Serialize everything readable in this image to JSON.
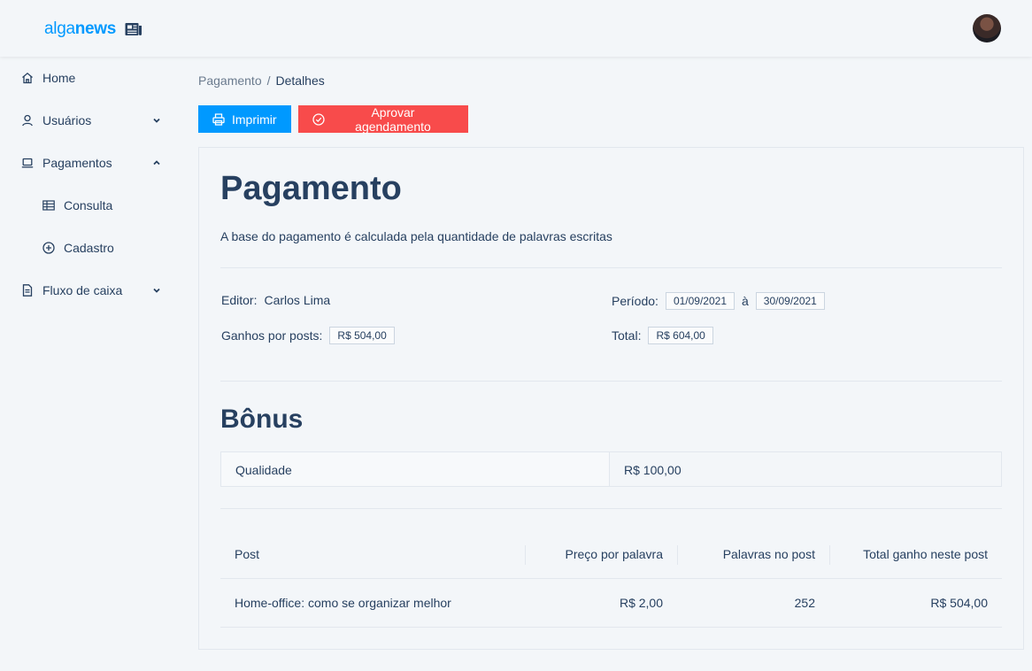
{
  "header": {
    "logo_part1": "alga",
    "logo_part2": "news",
    "logo_icon": "newspaper-icon",
    "avatar_icon": "user-avatar"
  },
  "sidebar": {
    "items": [
      {
        "label": "Home",
        "icon": "home-icon"
      },
      {
        "label": "Usuários",
        "icon": "user-icon",
        "chevron": "chevron-down"
      },
      {
        "label": "Pagamentos",
        "icon": "laptop-icon",
        "chevron": "chevron-up"
      },
      {
        "label": "Consulta",
        "icon": "table-icon"
      },
      {
        "label": "Cadastro",
        "icon": "plus-circle-icon"
      },
      {
        "label": "Fluxo de caixa",
        "icon": "file-icon",
        "chevron": "chevron-down"
      }
    ]
  },
  "breadcrumb": {
    "parent": "Pagamento",
    "separator": "/",
    "current": "Detalhes"
  },
  "actions": {
    "print_label": "Imprimir",
    "approve_label": "Aprovar agendamento"
  },
  "payment": {
    "title": "Pagamento",
    "description": "A base do pagamento é calculada pela quantidade de palavras escritas",
    "editor_label": "Editor",
    "editor_value": "Carlos Lima",
    "earnings_label": "Ganhos por posts",
    "earnings_value": "R$ 504,00",
    "period_label": "Período",
    "period_start": "01/09/2021",
    "period_connector": "à",
    "period_end": "30/09/2021",
    "total_label": "Total",
    "total_value": "R$ 604,00"
  },
  "bonus": {
    "title": "Bônus",
    "rows": [
      {
        "name": "Qualidade",
        "value": "R$ 100,00"
      }
    ]
  },
  "posts": {
    "headers": [
      "Post",
      "Preço por palavra",
      "Palavras no post",
      "Total ganho neste post"
    ],
    "rows": [
      [
        "Home-office: como se organizar melhor",
        "R$ 2,00",
        "252",
        "R$ 504,00"
      ]
    ]
  },
  "colors": {
    "primary": "#0099ff",
    "danger": "#f84b4b",
    "text": "#274060",
    "background": "#f3f6f9"
  }
}
